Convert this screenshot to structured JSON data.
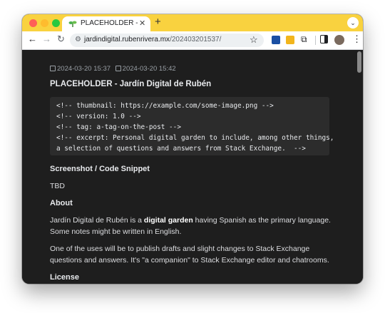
{
  "tab": {
    "title": "PLACEHOLDER - Jardín Digi",
    "close": "✕",
    "new_tab": "+",
    "menu": "⌄"
  },
  "toolbar": {
    "back": "←",
    "forward": "→",
    "reload": "↻",
    "url_host": "jardindigital.rubenrivera.mx",
    "url_path": "/202403201537/",
    "star": "☆",
    "puzzle": "⧉",
    "kebab": "⋮"
  },
  "page": {
    "created": "2024-03-20 15:37",
    "updated": "2024-03-20 15:42",
    "title": "PLACEHOLDER - Jardín Digital de Rubén",
    "code_lines": [
      "<!-- thumbnail: https://example.com/some-image.png -->",
      "<!-- version: 1.0 -->",
      "<!-- tag: a-tag-on-the-post -->",
      "<!-- excerpt: Personal digital garden to include, among other things,",
      "a selection of questions and answers from Stack Exchange.  -->"
    ],
    "section_screenshot": "Screenshot / Code Snippet",
    "tbd": "TBD",
    "section_about": "About",
    "about_p1_a": "Jardín Digital de Rubén is a ",
    "about_p1_bold": "digital garden",
    "about_p1_b": " having Spanish as the primary language.",
    "about_p1_line2": "Some notes might be written in English.",
    "about_p2_line1": "One of the uses will be to publish drafts and slight changes to Stack Exchange",
    "about_p2_line2": "questions and answers. It's \"a companion\" to Stack Exchange editor and chatrooms.",
    "section_license": "License"
  },
  "colors": {
    "tabstrip": "#f9d23f",
    "page_bg": "#1e1e1e",
    "code_bg": "#2c2c2c"
  }
}
